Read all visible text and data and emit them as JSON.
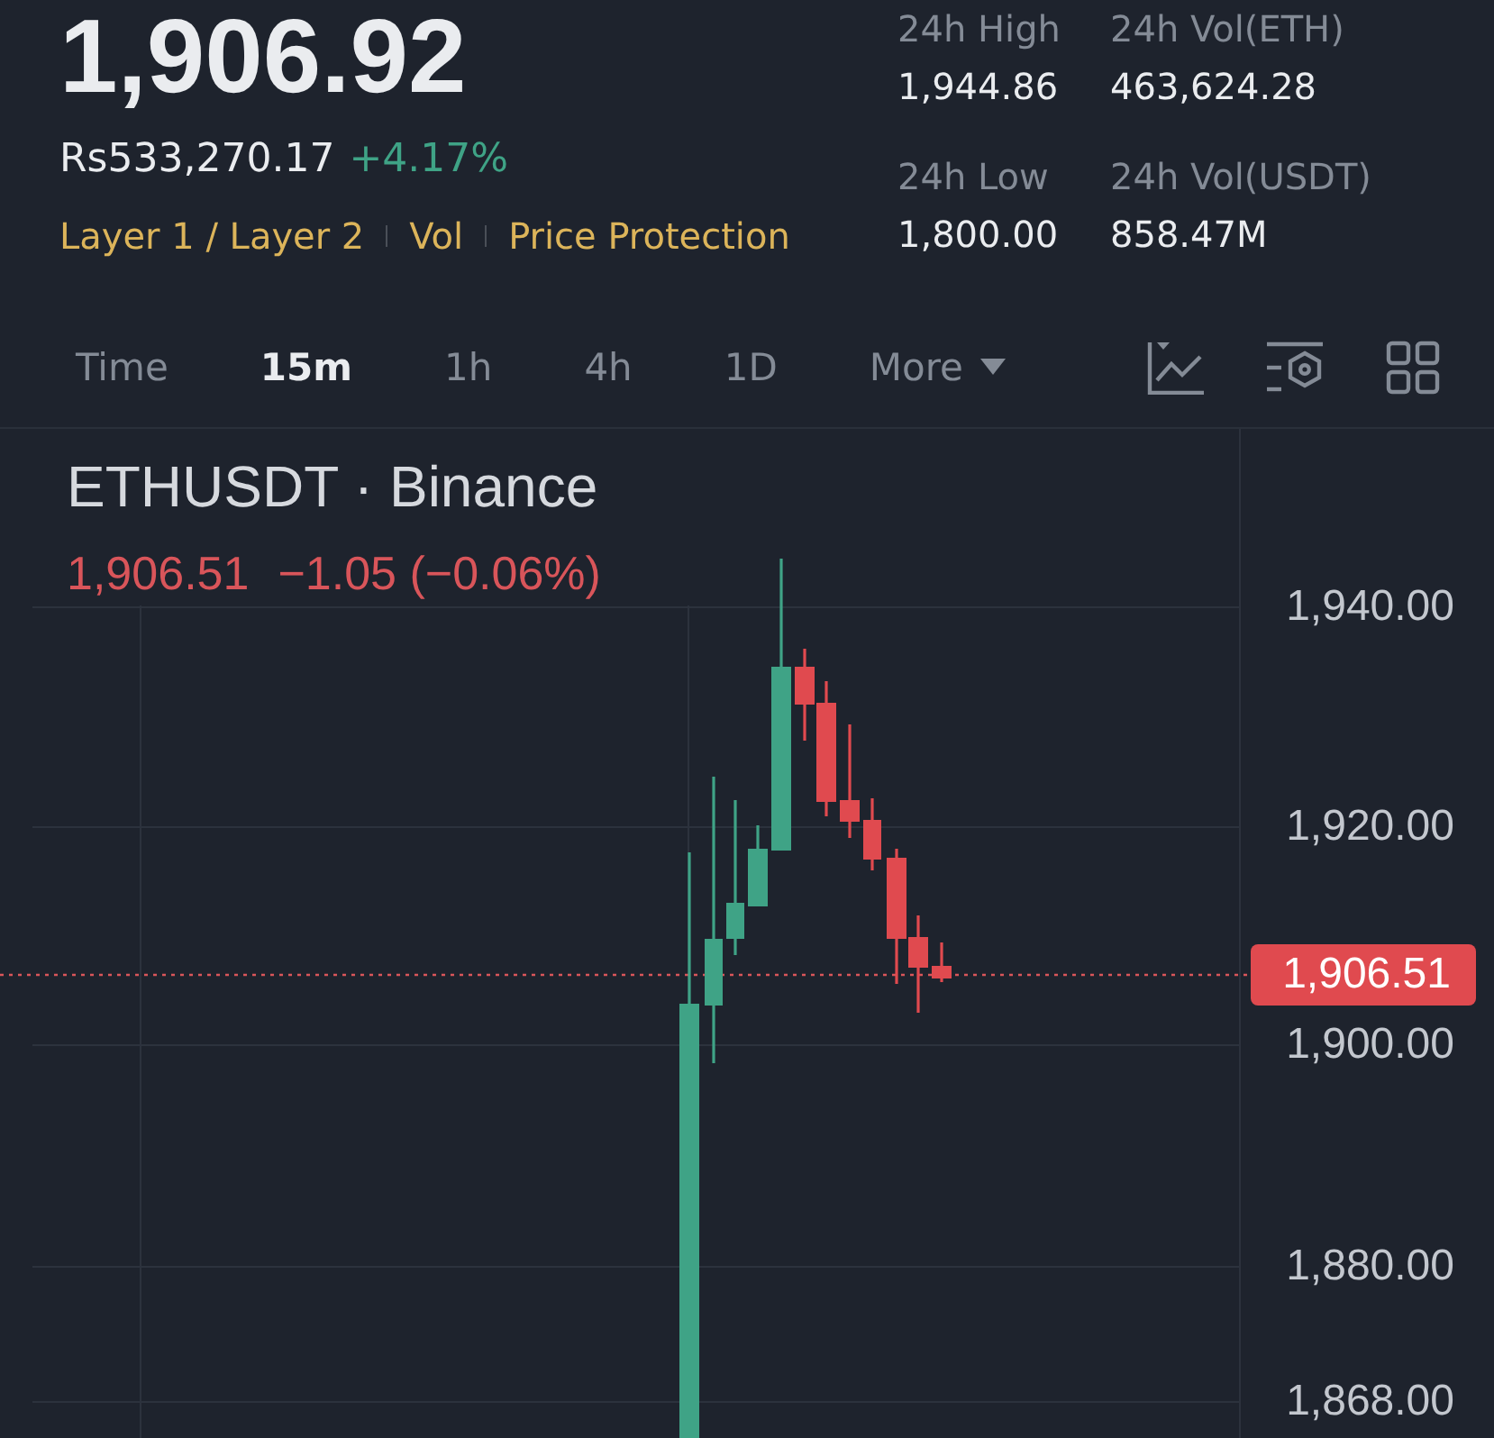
{
  "ticker": {
    "price": "1,906.92",
    "fiat_price": "Rs533,270.17",
    "change": "+4.17%",
    "tags": [
      "Layer 1 / Layer 2",
      "Vol",
      "Price Protection"
    ]
  },
  "stats": [
    {
      "label": "24h High",
      "value": "1,944.86"
    },
    {
      "label": "24h Vol(ETH)",
      "value": "463,624.28"
    },
    {
      "label": "24h Low",
      "value": "1,800.00"
    },
    {
      "label": "24h Vol(USDT)",
      "value": "858.47M"
    }
  ],
  "intervals": [
    {
      "label": "Time",
      "selected": false
    },
    {
      "label": "15m",
      "selected": true
    },
    {
      "label": "1h",
      "selected": false
    },
    {
      "label": "4h",
      "selected": false
    },
    {
      "label": "1D",
      "selected": false
    }
  ],
  "more_menu": {
    "label": "More"
  },
  "chart": {
    "symbol": "ETHUSDT · Binance",
    "last": "1,906.51",
    "change": "−1.05 (−0.06%)",
    "price_axis": [
      "1,940.00",
      "1,920.00",
      "1,900.00",
      "1,880.00",
      "1,868.00"
    ],
    "last_price_tag": "1,906.51"
  }
}
